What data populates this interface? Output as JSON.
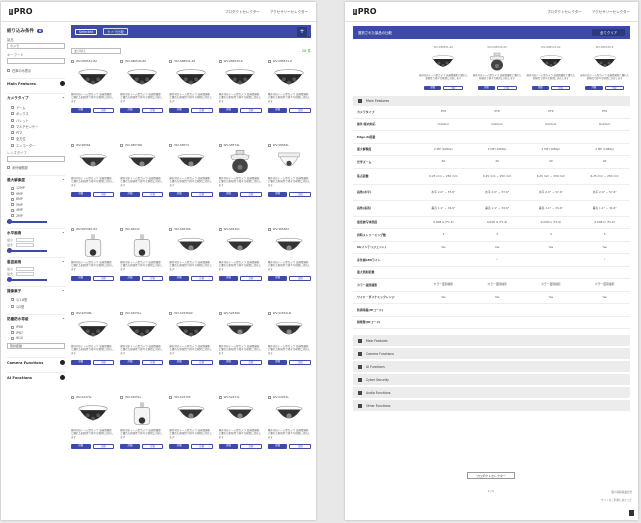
{
  "brand": {
    "logo": "PRO",
    "logo_prefix": "i"
  },
  "header": {
    "nav": [
      "プロダクトセレクター",
      "アクセサリーセレクター"
    ]
  },
  "sidebar": {
    "title": "絞り込み条件",
    "badge": "0",
    "product_label": "製品",
    "product_value": "カメラ",
    "keyword_label": "キーワード",
    "stock_label": "在庫のみ表示",
    "main_features": "Main Features",
    "camera_type": "カメラタイプ",
    "camera_types": [
      "ドーム",
      "ボックス",
      "バレット",
      "マルチセンサー",
      "PTZ",
      "全方位",
      "エンコーダー"
    ],
    "lens_label": "レンズタイプ",
    "lens_value": "",
    "ir_label": "赤外線照射",
    "resolution": "最大解像度",
    "resolutions": [
      "12MP",
      "9MP",
      "6MP",
      "5MP",
      "4MP",
      "2MP"
    ],
    "field_h": "水平画角",
    "field_v": "垂直画角",
    "min": "最小",
    "max": "最大",
    "distance": "照射距離",
    "sensor": "撮像素子",
    "sensor_opts": [
      "1/1.8型",
      "1/2型"
    ],
    "dust": "防塵防水等級",
    "dust_opts": [
      "IP66",
      "IP67",
      "IK10"
    ],
    "sec_camera": "Camera Functions",
    "sec_ai": "AI Functions"
  },
  "main": {
    "tabs": [
      "Selected",
      "カメラ比較"
    ],
    "sort_value": "並び替え",
    "count": "28 件",
    "detail_label": "詳細",
    "compare_label": "比較",
    "desc": "屋外対応ドーム型カメラ 高画質撮影と優れた耐候性で様々な現場に対応します",
    "models": [
      [
        "WV-X86531-Z2",
        "WV-X86530-Z2",
        "WV-S86531-Z2",
        "WV-X86530-Z",
        "WV-X86531-Z"
      ],
      [
        "WV-S8564",
        "WV-X8570N",
        "WV-S8574",
        "WV-S8574L",
        "WV-S8564L"
      ],
      [
        "WV-S65340-Z4",
        "WV-S6532",
        "WV-S65300",
        "WV-S65301",
        "WV-S65302"
      ],
      [
        "WV-S2536L",
        "WV-S2531L",
        "WV-S2536LN",
        "WV-S25360",
        "WV-S2531LN"
      ],
      [
        "WV-X2271L",
        "WV-X2551L",
        "WV-S22700",
        "WV-S2271L",
        "WV-X2251L"
      ]
    ]
  },
  "compare": {
    "title": "選択された製品の比較",
    "clear_btn": "全てクリア",
    "models": [
      "WV-X86531-Z2",
      "WV-X86530-Z2",
      "WV-S86531-Z2",
      "WV-X86530-Z"
    ],
    "section_main": "Main Features",
    "rows": [
      {
        "k": "カメラタイプ",
        "v": [
          "PTZ",
          "PTZ",
          "PTZ",
          "PTZ"
        ]
      },
      {
        "k": "屋外/屋内対応",
        "v": [
          "Outdoor",
          "Outdoor",
          "Outdoor",
          "Outdoor"
        ]
      },
      {
        "k": "Edge AI搭載",
        "v": [
          "",
          "",
          "",
          ""
        ]
      },
      {
        "k": "最大解像度",
        "v": [
          "2 MP (1080p)",
          "2 MP (1080p)",
          "2 MP (1080p)",
          "2 MP (1080p)"
        ]
      },
      {
        "k": "光学ズーム",
        "v": [
          "40",
          "40",
          "40",
          "40"
        ]
      },
      {
        "k": "焦点距離",
        "v": [
          "6.25 mm ~ 250 mm",
          "6.25 mm ~ 250 mm",
          "6.25 mm ~ 250 mm",
          "6.25 mm ~ 250 mm"
        ]
      },
      {
        "k": "画角(水平)",
        "v": [
          "水平 2.0° ~ 57.6°",
          "水平 2.0° ~ 57.6°",
          "水平 2.0° ~ 57.6°",
          "水平 2.0° ~ 57.6°"
        ]
      },
      {
        "k": "画角(垂直)",
        "v": [
          "垂直 1.1° ~ 34.6°",
          "垂直 1.1° ~ 34.6°",
          "垂直 1.1° ~ 34.6°",
          "垂直 1.1° ~ 34.6°"
        ]
      },
      {
        "k": "最低被写体照度",
        "v": [
          "0.008 lx (F1.6)",
          "0.008 lx (F1.6)",
          "0.008 lx (F1.6)",
          "0.008 lx (F1.6)"
        ]
      },
      {
        "k": "同時ストリーミング数",
        "v": [
          "4",
          "4",
          "4",
          "4"
        ]
      },
      {
        "k": "iA(インテリジェント)",
        "v": [
          "Yes",
          "Yes",
          "Yes",
          "Yes"
        ]
      },
      {
        "k": "赤外線LEDライト",
        "v": [
          "",
          "✓",
          "",
          "✓"
        ]
      },
      {
        "k": "最大照射距離",
        "v": [
          "",
          "",
          "",
          ""
        ]
      },
      {
        "k": "カラー夜間撮影",
        "v": [
          "カラー夜間撮影",
          "カラー夜間撮影",
          "カラー夜間撮影",
          "カラー夜間撮影"
        ]
      },
      {
        "k": "ワイド・ダイナミックレンジ",
        "v": [
          "Yes",
          "Yes",
          "Yes",
          "Yes"
        ]
      },
      {
        "k": "防滴等級(IPコード)",
        "v": [
          "",
          "",
          "",
          ""
        ]
      },
      {
        "k": "耐衝撃(IKコード)",
        "v": [
          "",
          "",
          "",
          ""
        ]
      }
    ],
    "sections": [
      "Main Features",
      "Camera Functions",
      "AI Functions",
      "Cyber Security",
      "Audio Functions",
      "Other Functions"
    ],
    "back_btn": "プロダクトセレクター",
    "pager": "1 / 1",
    "footer": [
      "個人情報保護方針",
      "サイトのご利用にあたって"
    ]
  }
}
